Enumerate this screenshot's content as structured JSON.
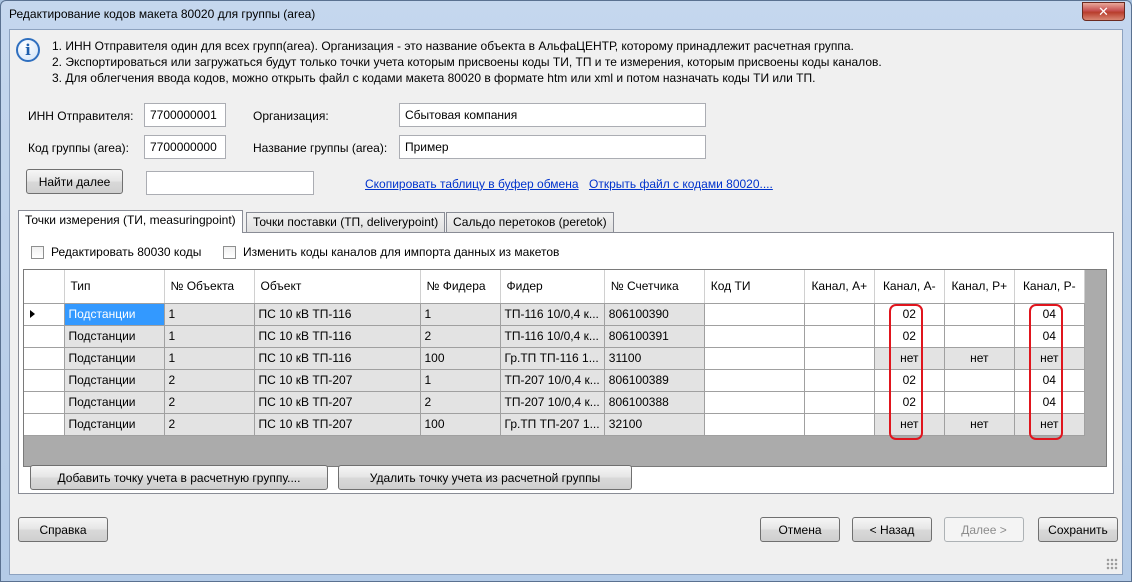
{
  "window": {
    "title": "Редактирование кодов макета 80020 для группы (area)",
    "close_label": "✕"
  },
  "info": {
    "line1": "1. ИНН Отправителя один для всех групп(area). Организация - это название объекта в АльфаЦЕНТР, которому принадлежит расчетная группа.",
    "line2": "2. Экспортироваться или загружаться будут только точки учета которым присвоены коды ТИ, ТП и те измерения, которым присвоены коды каналов.",
    "line3": "3. Для облегчения ввода кодов, можно открыть файл с кодами макета 80020 в формате htm или xml и потом назначать коды ТИ или ТП."
  },
  "form": {
    "inn_label": "ИНН Отправителя:",
    "inn_value": "7700000001",
    "org_label": "Организация:",
    "org_value": "Сбытовая компания",
    "group_code_label": "Код группы (area):",
    "group_code_value": "7700000000",
    "group_name_label": "Название группы (area):",
    "group_name_value": "Пример",
    "find_next_label": "Найти далее",
    "search_value": "",
    "copy_link": "Скопировать таблицу в буфер обмена",
    "open_link": "Открыть файл с кодами 80020...."
  },
  "tabs": [
    {
      "label": "Точки измерения (ТИ, measuringpoint)"
    },
    {
      "label": "Точки поставки (ТП, deliverypoint)"
    },
    {
      "label": "Сальдо перетоков (peretok)"
    }
  ],
  "options": {
    "edit_80030": "Редактировать 80030 коды",
    "change_codes": "Изменить коды каналов для импорта данных из макетов"
  },
  "grid": {
    "headers": [
      "Тип",
      "№ Объекта",
      "Объект",
      "№ Фидера",
      "Фидер",
      "№ Счетчика",
      "Код ТИ",
      "Канал, А+",
      "Канал, А-",
      "Канал, Р+",
      "Канал, Р-"
    ],
    "rows": [
      [
        "Подстанции",
        "1",
        "ПС 10 кВ ТП-116",
        "1",
        "ТП-116 10/0,4 к...",
        "806100390",
        "",
        "",
        "02",
        "",
        "04"
      ],
      [
        "Подстанции",
        "1",
        "ПС 10 кВ ТП-116",
        "2",
        "ТП-116 10/0,4 к...",
        "806100391",
        "",
        "",
        "02",
        "",
        "04"
      ],
      [
        "Подстанции",
        "1",
        "ПС 10 кВ ТП-116",
        "100",
        "Гр.ТП ТП-116 1...",
        "31100",
        "",
        "",
        "нет",
        "нет",
        "нет"
      ],
      [
        "Подстанции",
        "2",
        "ПС 10 кВ ТП-207",
        "1",
        "ТП-207 10/0,4 к...",
        "806100389",
        "",
        "",
        "02",
        "",
        "04"
      ],
      [
        "Подстанции",
        "2",
        "ПС 10 кВ ТП-207",
        "2",
        "ТП-207 10/0,4 к...",
        "806100388",
        "",
        "",
        "02",
        "",
        "04"
      ],
      [
        "Подстанции",
        "2",
        "ПС 10 кВ ТП-207",
        "100",
        "Гр.ТП ТП-207 1...",
        "32100",
        "",
        "",
        "нет",
        "нет",
        "нет"
      ]
    ]
  },
  "actions": {
    "add_point": "Добавить точку учета в расчетную группу....",
    "remove_point": "Удалить точку учета из расчетной группы",
    "help": "Справка",
    "cancel": "Отмена",
    "back": "< Назад",
    "next": "Далее >",
    "save": "Сохранить"
  },
  "colors": {
    "selection": "#3399ff",
    "highlight": "#e0151d",
    "link": "#0033cc"
  }
}
